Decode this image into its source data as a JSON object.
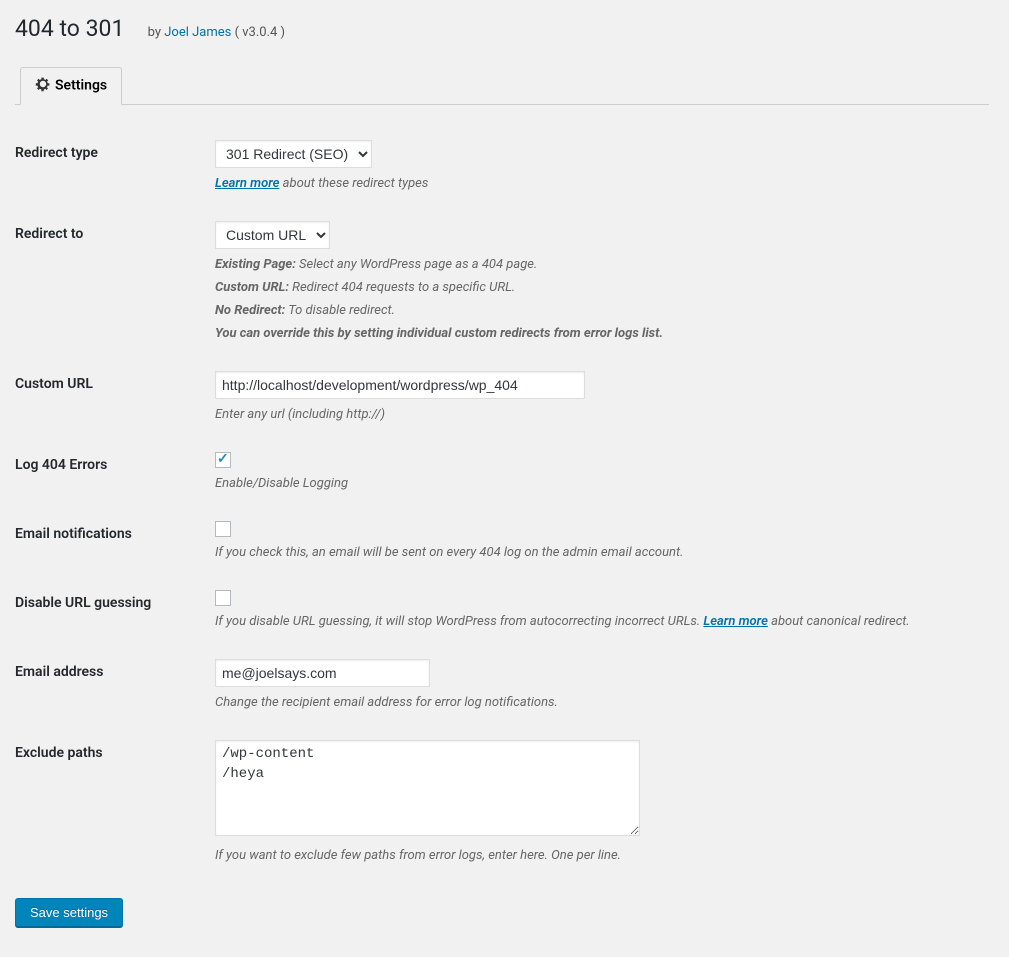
{
  "header": {
    "title": "404 to 301",
    "by_prefix": "by ",
    "author": "Joel James",
    "version": " ( v3.0.4 )"
  },
  "tabs": {
    "settings": "Settings"
  },
  "fields": {
    "redirect_type": {
      "label": "Redirect type",
      "selected": "301 Redirect (SEO)",
      "learn_more": "Learn more",
      "learn_more_suffix": " about these redirect types"
    },
    "redirect_to": {
      "label": "Redirect to",
      "selected": "Custom URL",
      "desc_existing_label": "Existing Page:",
      "desc_existing_text": " Select any WordPress page as a 404 page.",
      "desc_custom_label": "Custom URL:",
      "desc_custom_text": " Redirect 404 requests to a specific URL.",
      "desc_noredirect_label": "No Redirect:",
      "desc_noredirect_text": " To disable redirect.",
      "desc_override": "You can override this by setting individual custom redirects from error logs list."
    },
    "custom_url": {
      "label": "Custom URL",
      "value": "http://localhost/development/wordpress/wp_404",
      "desc": "Enter any url (including http://)"
    },
    "log_errors": {
      "label": "Log 404 Errors",
      "checked": true,
      "desc": "Enable/Disable Logging"
    },
    "email_notifications": {
      "label": "Email notifications",
      "checked": false,
      "desc": "If you check this, an email will be sent on every 404 log on the admin email account."
    },
    "disable_url_guessing": {
      "label": "Disable URL guessing",
      "checked": false,
      "desc_prefix": "If you disable URL guessing, it will stop WordPress from autocorrecting incorrect URLs. ",
      "learn_more": "Learn more",
      "desc_suffix": " about canonical redirect."
    },
    "email_address": {
      "label": "Email address",
      "value": "me@joelsays.com",
      "desc": "Change the recipient email address for error log notifications."
    },
    "exclude_paths": {
      "label": "Exclude paths",
      "value": "/wp-content\n/heya",
      "desc": "If you want to exclude few paths from error logs, enter here. One per line."
    }
  },
  "buttons": {
    "save": "Save settings"
  }
}
